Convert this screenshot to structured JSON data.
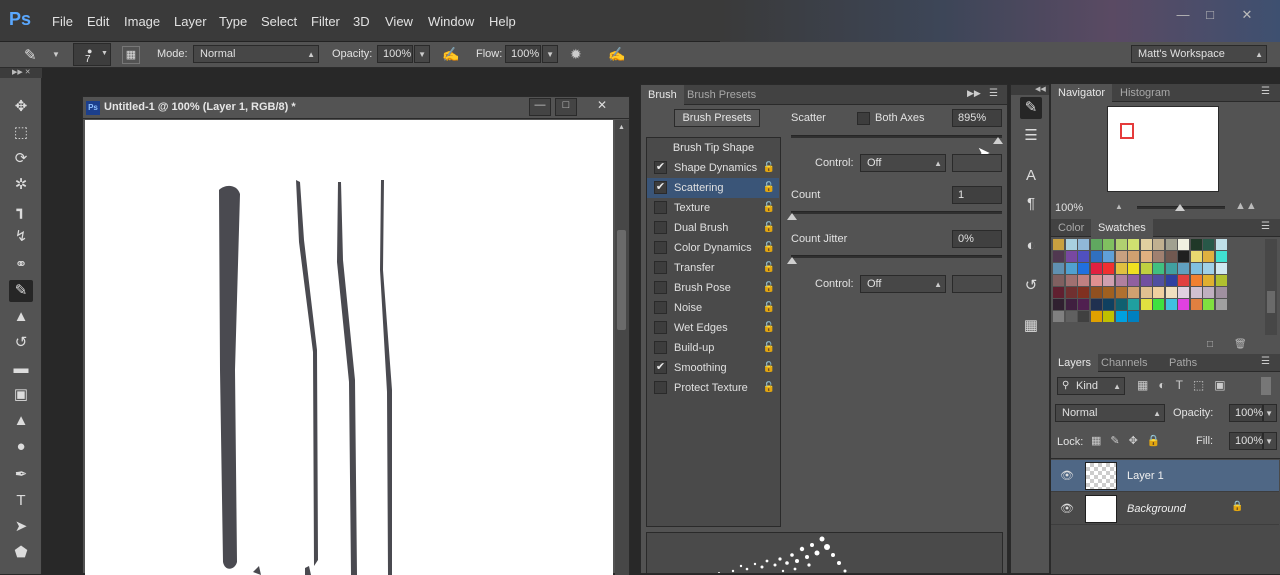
{
  "menubar": {
    "logo": "Ps",
    "items": [
      "File",
      "Edit",
      "Image",
      "Layer",
      "Type",
      "Select",
      "Filter",
      "3D",
      "View",
      "Window",
      "Help"
    ]
  },
  "options": {
    "brush_size": "7",
    "mode_label": "Mode:",
    "mode_value": "Normal",
    "opacity_label": "Opacity:",
    "opacity_value": "100%",
    "flow_label": "Flow:",
    "flow_value": "100%",
    "workspace": "Matt's Workspace"
  },
  "document": {
    "title": "Untitled-1 @ 100% (Layer 1, RGB/8) *",
    "icon": "Ps"
  },
  "brush_panel": {
    "tabs": [
      "Brush",
      "Brush Presets"
    ],
    "presets_button": "Brush Presets",
    "tip_shape": "Brush Tip Shape",
    "items": [
      {
        "label": "Shape Dynamics",
        "checked": true,
        "selected": false
      },
      {
        "label": "Scattering",
        "checked": true,
        "selected": true
      },
      {
        "label": "Texture",
        "checked": false,
        "selected": false
      },
      {
        "label": "Dual Brush",
        "checked": false,
        "selected": false
      },
      {
        "label": "Color Dynamics",
        "checked": false,
        "selected": false
      },
      {
        "label": "Transfer",
        "checked": false,
        "selected": false
      },
      {
        "label": "Brush Pose",
        "checked": false,
        "selected": false
      },
      {
        "label": "Noise",
        "checked": false,
        "selected": false
      },
      {
        "label": "Wet Edges",
        "checked": false,
        "selected": false
      },
      {
        "label": "Build-up",
        "checked": false,
        "selected": false
      },
      {
        "label": "Smoothing",
        "checked": true,
        "selected": false
      },
      {
        "label": "Protect Texture",
        "checked": false,
        "selected": false
      }
    ],
    "scatter_label": "Scatter",
    "both_axes_label": "Both Axes",
    "scatter_value": "895%",
    "control_label": "Control:",
    "control_value": "Off",
    "count_label": "Count",
    "count_value": "1",
    "count_jitter_label": "Count Jitter",
    "count_jitter_value": "0%",
    "control2_label": "Control:",
    "control2_value": "Off",
    "scatter_fraction": 0.98
  },
  "navigator": {
    "tabs": [
      "Navigator",
      "Histogram"
    ],
    "zoom": "100%"
  },
  "color_panel": {
    "tabs": [
      "Color",
      "Swatches"
    ]
  },
  "layers_panel": {
    "tabs": [
      "Layers",
      "Channels",
      "Paths"
    ],
    "kind": "Kind",
    "blend": "Normal",
    "opacity_label": "Opacity:",
    "opacity_value": "100%",
    "lock_label": "Lock:",
    "fill_label": "Fill:",
    "fill_value": "100%",
    "layers": [
      {
        "name": "Layer 1",
        "selected": true
      },
      {
        "name": "Background",
        "selected": false
      }
    ]
  },
  "colors": {
    "accent": "#3a5578",
    "stroke": "#4a4a50"
  }
}
